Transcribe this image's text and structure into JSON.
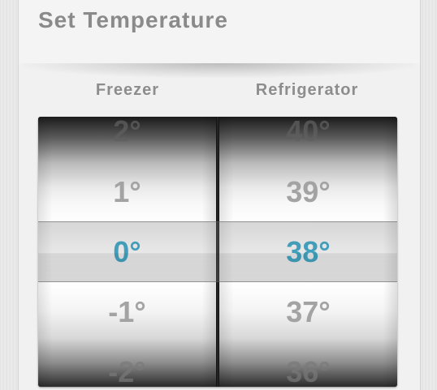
{
  "title": "Set Temperature",
  "columns": {
    "freezer": {
      "label": "Freezer",
      "values": [
        "2°",
        "1°",
        "0°",
        "-1°",
        "-2°"
      ],
      "selected": "0°"
    },
    "refrigerator": {
      "label": "Refrigerator",
      "values": [
        "40°",
        "39°",
        "38°",
        "37°",
        "36°"
      ],
      "selected": "38°"
    }
  },
  "colors": {
    "selected_value": "#2aa3c8",
    "unselected_value": "#a3a3a3",
    "title_text": "#8a8a8a"
  }
}
